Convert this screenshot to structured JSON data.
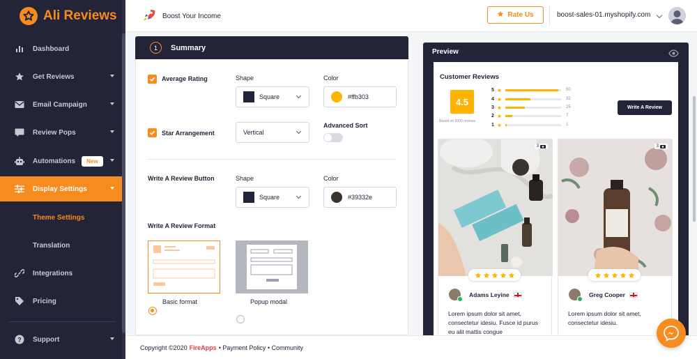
{
  "app": {
    "logo_text": "Ali Reviews"
  },
  "sidebar": {
    "items": [
      {
        "label": "Dashboard",
        "icon": "bar-chart-icon"
      },
      {
        "label": "Get Reviews",
        "icon": "star-icon"
      },
      {
        "label": "Email Campaign",
        "icon": "mail-icon"
      },
      {
        "label": "Review Pops",
        "icon": "popup-icon"
      },
      {
        "label": "Automations",
        "icon": "robot-icon",
        "badge": "New"
      },
      {
        "label": "Display Settings",
        "icon": "sliders-icon"
      },
      {
        "label": "Integrations",
        "icon": "link-icon"
      },
      {
        "label": "Pricing",
        "icon": "tag-icon"
      },
      {
        "label": "Support",
        "icon": "help-icon"
      }
    ],
    "subitems": [
      {
        "label": "Theme Settings"
      },
      {
        "label": "Translation"
      }
    ]
  },
  "header": {
    "boost_label": "Boost Your Income",
    "rate_label": "Rate Us",
    "shop": "boost-sales-01.myshopify.com"
  },
  "summary": {
    "step": "1",
    "title": "Summary",
    "average_rating_label": "Average Rating",
    "star_arrangement_label": "Star Arrangement",
    "shape_label": "Shape",
    "color_label": "Color",
    "rating_shape": "Square",
    "rating_color": "#ffb303",
    "arrangement_value": "Vertical",
    "advanced_sort_label": "Advanced Sort",
    "write_button_label": "Write A Review Button",
    "button_shape_label": "Shape",
    "button_color_label": "Color",
    "button_shape": "Square",
    "button_color": "#39332e",
    "format_label": "Write A Review Format",
    "format_basic": "Basic format",
    "format_popup": "Popup modal"
  },
  "footer": {
    "copyright": "Copyright ©2020",
    "brand": "FireApps",
    "links": "• Payment Policy • Community"
  },
  "preview": {
    "title": "Preview",
    "widget_title": "Customer Reviews",
    "score": "4.5",
    "based_on": "Based on 5000 reviews",
    "write_button": "Write A Review",
    "distribution": [
      {
        "stars": "5",
        "count": "50",
        "fraction": 0.95
      },
      {
        "stars": "4",
        "count": "32",
        "fraction": 0.45
      },
      {
        "stars": "3",
        "count": "25",
        "fraction": 0.35
      },
      {
        "stars": "2",
        "count": "7",
        "fraction": 0.12
      },
      {
        "stars": "1",
        "count": "1",
        "fraction": 0.03
      }
    ],
    "reviews": [
      {
        "name": "Adams Leyine",
        "photo_count": "3",
        "rating": 5,
        "text": "Lorem ipsum dolor sit amet, consectetur idesiu. Fusce id purus eu alit mattis congue"
      },
      {
        "name": "Greg Cooper",
        "photo_count": "3",
        "rating": 5,
        "text": "Lorem ipsum dolor sit amet, consectetur idesiu."
      }
    ]
  },
  "colors": {
    "accent": "#f68b1f",
    "sidebar_bg": "#232437",
    "star": "#ffb303"
  }
}
